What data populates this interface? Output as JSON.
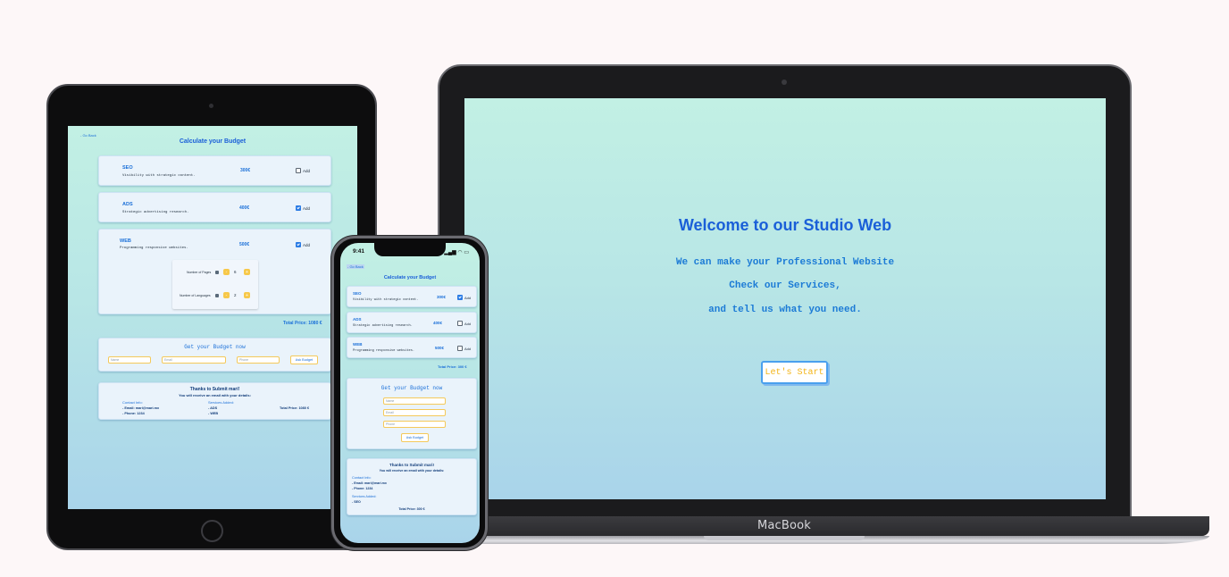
{
  "laptop": {
    "brand": "MacBook",
    "title": "Welcome to our Studio Web",
    "lines": [
      "We can make your Professional Website",
      "Check our Services,",
      "and tell us what you need."
    ],
    "start_button": "Let's Start"
  },
  "tablet": {
    "go_back": "- Go Back",
    "heading": "Calculate your Budget",
    "services": [
      {
        "name": "SEO",
        "description": "Visibility with strategic content.",
        "price": "300€",
        "checked": false,
        "check_label": "Add"
      },
      {
        "name": "ADS",
        "description": "Strategic advertising research.",
        "price": "400€",
        "checked": true,
        "check_label": "Add"
      },
      {
        "name": "WEB",
        "description": "Programming responsive websites.",
        "price": "500€",
        "checked": true,
        "check_label": "Add"
      }
    ],
    "pages_label": "Number of Pages",
    "pages_value": "6",
    "languages_label": "Number of Languages",
    "languages_value": "2",
    "stepper_minus": "-",
    "stepper_plus": "+",
    "total": "Total Price: 1080 €",
    "form_title": "Get your Budget now",
    "name_placeholder": "Name",
    "email_placeholder": "Email",
    "phone_placeholder": "Phone",
    "ask_button": "Ask Budget",
    "thanks": "Thanks to Submit mari!",
    "email_note": "You will receive an email with your details:",
    "contact_heading": "Contact Info:",
    "contact_email": "- Email: mari@mari.mx",
    "contact_phone": "- Phone: 1234",
    "services_heading": "Services Added:",
    "services_added": [
      "- ADS",
      "- WEB"
    ],
    "summary_total": "Total Price: 1080 €"
  },
  "phone": {
    "time": "9:41",
    "status_icons": "▂▄▆ ◠ ▭",
    "go_back": "- Go Back",
    "heading": "Calculate your Budget",
    "services": [
      {
        "name": "SEO",
        "description": "Visibility with strategic content.",
        "price": "300€",
        "checked": true,
        "check_label": "Add"
      },
      {
        "name": "ADS",
        "description": "Strategic advertising research.",
        "price": "400€",
        "checked": false,
        "check_label": "Add"
      },
      {
        "name": "WEB",
        "description": "Programming responsive websites.",
        "price": "500€",
        "checked": false,
        "check_label": "Add"
      }
    ],
    "total": "Total Price: 300 €",
    "form_title": "Get your Budget now",
    "name_placeholder": "Name",
    "email_placeholder": "Email",
    "phone_placeholder": "Phone",
    "ask_button": "Ask Budget",
    "thanks": "Thanks to Submit mari!",
    "email_note": "You will receive an email with your details:",
    "contact_heading": "Contact Info:",
    "contact_email": "- Email: mari@mari.mx",
    "contact_phone": "- Phone: 1234",
    "services_heading": "Services Added:",
    "services_added": [
      "- SEO"
    ],
    "summary_total": "Total Price: 300 €"
  }
}
